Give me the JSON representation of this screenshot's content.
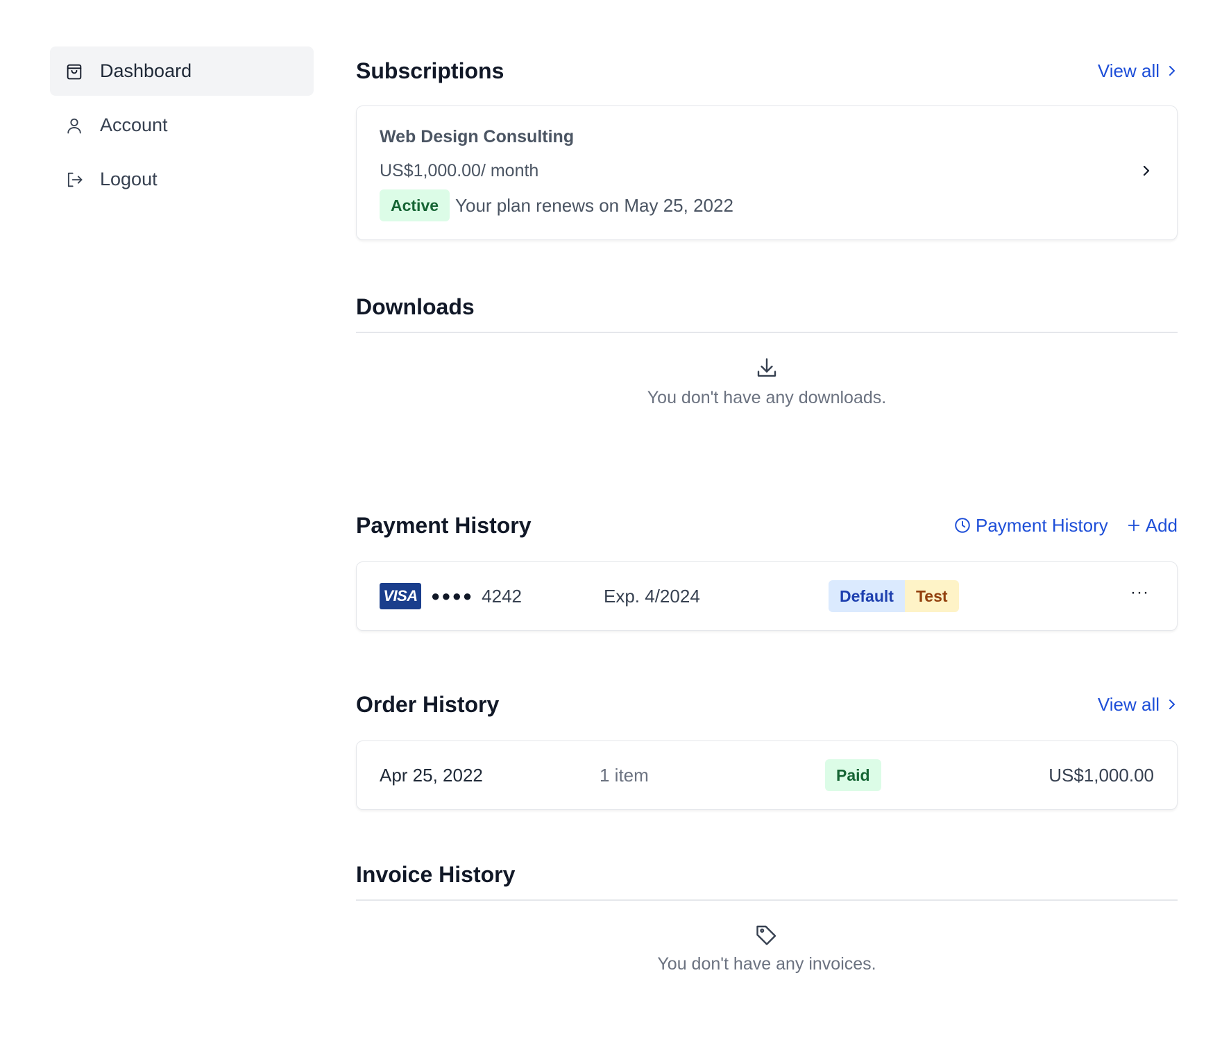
{
  "sidebar": {
    "items": [
      {
        "label": "Dashboard",
        "icon": "shopping-bag-icon",
        "active": true
      },
      {
        "label": "Account",
        "icon": "user-icon",
        "active": false
      },
      {
        "label": "Logout",
        "icon": "logout-icon",
        "active": false
      }
    ]
  },
  "subscriptions": {
    "title": "Subscriptions",
    "view_all": "View all",
    "item": {
      "name": "Web Design Consulting",
      "price": "US$1,000.00/ month",
      "status": "Active",
      "renew_text": "Your plan renews on May 25, 2022"
    }
  },
  "downloads": {
    "title": "Downloads",
    "empty_text": "You don't have any downloads."
  },
  "payment": {
    "title": "Payment History",
    "history_link": "Payment History",
    "add_link": "Add",
    "method": {
      "brand": "VISA",
      "masked": "●●●●",
      "last4": "4242",
      "expiry": "Exp. 4/2024",
      "badge_default": "Default",
      "badge_test": "Test",
      "more": "···"
    }
  },
  "orders": {
    "title": "Order History",
    "view_all": "View all",
    "row": {
      "date": "Apr 25, 2022",
      "items": "1 item",
      "status": "Paid",
      "total": "US$1,000.00"
    }
  },
  "invoices": {
    "title": "Invoice History",
    "empty_text": "You don't have any invoices."
  },
  "colors": {
    "link": "#1d4ed8",
    "active_bg": "#f3f4f6",
    "success_bg": "#dcfce7",
    "success_text": "#166534",
    "info_bg": "#dbeafe",
    "warn_bg": "#fef3c7",
    "visa_blue": "#1a3e8c"
  }
}
